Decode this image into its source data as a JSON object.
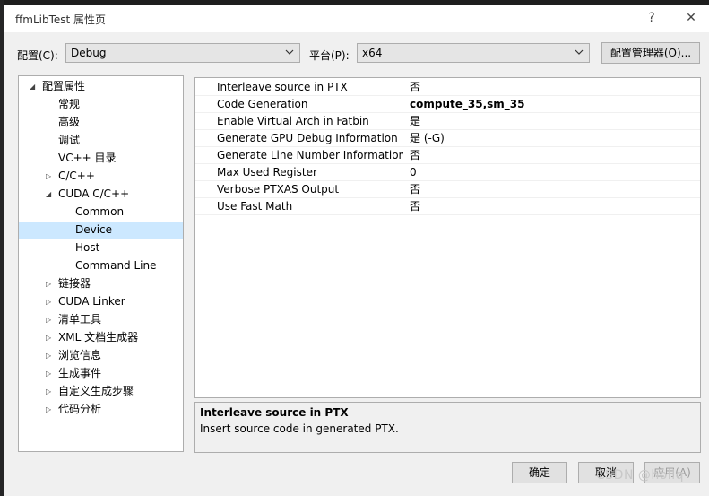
{
  "window": {
    "title": "ffmLibTest 属性页",
    "help_label": "?",
    "close_label": "✕"
  },
  "toolbar": {
    "config_label": "配置(C):",
    "config_value": "Debug",
    "platform_label": "平台(P):",
    "platform_value": "x64",
    "config_manager_label": "配置管理器(O)..."
  },
  "tree": {
    "items": [
      {
        "label": "配置属性",
        "expander": "◢",
        "level": 0
      },
      {
        "label": "常规",
        "expander": "",
        "level": 1
      },
      {
        "label": "高级",
        "expander": "",
        "level": 1
      },
      {
        "label": "调试",
        "expander": "",
        "level": 1
      },
      {
        "label": "VC++ 目录",
        "expander": "",
        "level": 1
      },
      {
        "label": "C/C++",
        "expander": "▷",
        "level": 1
      },
      {
        "label": "CUDA C/C++",
        "expander": "◢",
        "level": 1
      },
      {
        "label": "Common",
        "expander": "",
        "level": 2
      },
      {
        "label": "Device",
        "expander": "",
        "level": 2,
        "selected": true
      },
      {
        "label": "Host",
        "expander": "",
        "level": 2
      },
      {
        "label": "Command Line",
        "expander": "",
        "level": 2
      },
      {
        "label": "链接器",
        "expander": "▷",
        "level": 1
      },
      {
        "label": "CUDA Linker",
        "expander": "▷",
        "level": 1
      },
      {
        "label": "清单工具",
        "expander": "▷",
        "level": 1
      },
      {
        "label": "XML 文档生成器",
        "expander": "▷",
        "level": 1
      },
      {
        "label": "浏览信息",
        "expander": "▷",
        "level": 1
      },
      {
        "label": "生成事件",
        "expander": "▷",
        "level": 1
      },
      {
        "label": "自定义生成步骤",
        "expander": "▷",
        "level": 1
      },
      {
        "label": "代码分析",
        "expander": "▷",
        "level": 1
      }
    ]
  },
  "properties": [
    {
      "name": "Interleave source in PTX",
      "value": "否",
      "bold": false
    },
    {
      "name": "Code Generation",
      "value": "compute_35,sm_35",
      "bold": true
    },
    {
      "name": "Enable Virtual Arch in Fatbin",
      "value": "是",
      "bold": false
    },
    {
      "name": "Generate GPU Debug Information",
      "value": "是 (-G)",
      "bold": false
    },
    {
      "name": "Generate Line Number Information",
      "value": "否",
      "bold": false
    },
    {
      "name": "Max Used Register",
      "value": "0",
      "bold": false
    },
    {
      "name": "Verbose PTXAS Output",
      "value": "否",
      "bold": false
    },
    {
      "name": "Use Fast Math",
      "value": "否",
      "bold": false
    }
  ],
  "description": {
    "title": "Interleave source in PTX",
    "text": "Insert source code in generated PTX."
  },
  "buttons": {
    "ok": "确定",
    "cancel": "取消",
    "apply": "应用(A)"
  },
  "watermark": "CSDN @hollq"
}
